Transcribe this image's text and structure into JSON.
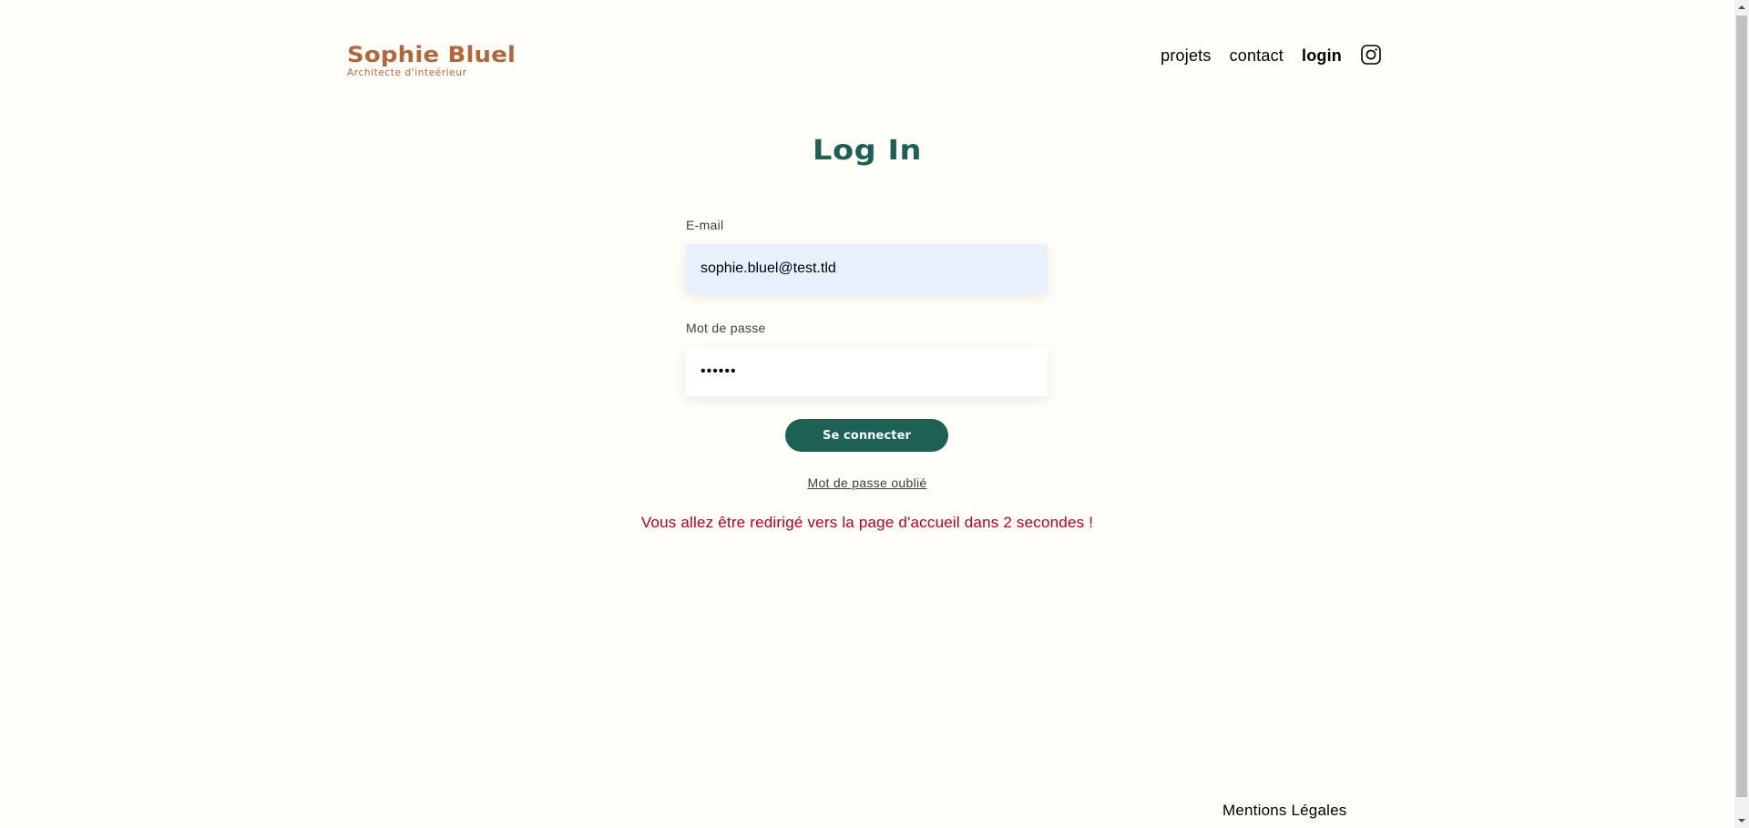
{
  "header": {
    "logo_title": "Sophie Bluel",
    "logo_subtitle": "Architecte d'inteérieur",
    "nav": {
      "projects": "projets",
      "contact": "contact",
      "login": "login"
    },
    "instagram_icon": "instagram-icon"
  },
  "main": {
    "title": "Log In",
    "email": {
      "label": "E-mail",
      "value": "sophie.bluel@test.tld"
    },
    "password": {
      "label": "Mot de passe",
      "value": "••••••"
    },
    "submit_label": "Se connecter",
    "forgot_label": "Mot de passe oublié",
    "redirect_message": "Vous allez être redirigé vers la page d'accueil dans 2 secondes !"
  },
  "footer": {
    "legal_label": "Mentions Légales"
  },
  "colors": {
    "brand": "#B1663C",
    "accent": "#1D6154",
    "error": "#B1001E",
    "background": "#FFFEF8",
    "autofill": "#E8F0FE"
  },
  "scrollbar": {
    "up_icon": "arrow-up-icon",
    "down_icon": "arrow-down-icon"
  }
}
